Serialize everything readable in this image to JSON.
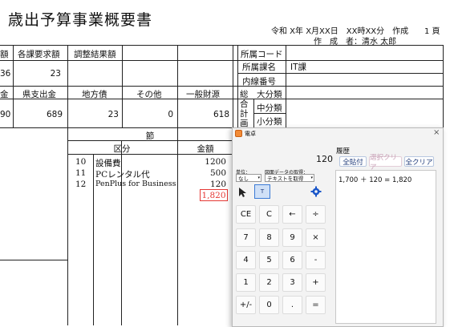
{
  "document": {
    "title": "歳出予算事業概要書",
    "header_date": "令和 X年 X月XX日　XX時XX分　作成",
    "page_number": "1 頁",
    "author": "作　成　者：清水 太郎",
    "row1": {
      "col_a": "額",
      "col_b": "各課要求額",
      "col_c": "調整結果額"
    },
    "row1_values": {
      "a": "36",
      "b": "23"
    },
    "row2": {
      "col_a": "金",
      "col_b": "県支出金",
      "col_c": "地方債",
      "col_d": "その他",
      "col_e": "一般財源"
    },
    "row2_values": {
      "a": "90",
      "b": "689",
      "c": "23",
      "d": "0",
      "e": "618"
    },
    "dept": {
      "code_label": "所属コード",
      "name_label": "所属課名",
      "name_value": "IT課",
      "ext_label": "内線番号"
    },
    "plan": {
      "label1": "総",
      "label2": "合",
      "label3": "計",
      "label4": "画",
      "large": "大分類",
      "mid": "中分類",
      "small": "小分類"
    },
    "section": {
      "header": "節",
      "col_category": "区分",
      "col_amount": "金額"
    },
    "items": [
      {
        "code": "10",
        "name": "設備費",
        "amount": "1200"
      },
      {
        "code": "11",
        "name": "PCレンタル代",
        "amount": "500"
      },
      {
        "code": "12",
        "name": "PenPlus for Business",
        "amount": "120"
      }
    ],
    "total": "1,820"
  },
  "calculator": {
    "window_title": "電卓",
    "close_glyph": "×",
    "display_value": "120",
    "unit_label": "単位：",
    "unit_value": "なし",
    "figure_label": "図面データの取得：",
    "figure_value": "テキストを取得",
    "history_label": "履歴",
    "btn_paste_all": "全貼付",
    "btn_sel_clear": "選択クリア",
    "btn_all_clear": "全クリア",
    "history_entries": [
      "1,700 ＋ 120 = 1,820"
    ],
    "keys": [
      [
        "CE",
        "C",
        "←",
        "÷"
      ],
      [
        "7",
        "8",
        "9",
        "×"
      ],
      [
        "4",
        "5",
        "6",
        "-"
      ],
      [
        "1",
        "2",
        "3",
        "+"
      ],
      [
        "+/-",
        "0",
        ".",
        "="
      ]
    ],
    "colors": {
      "accent": "#1f5fbf",
      "highlight_box": "#e53935",
      "gear": "#1a56c9"
    }
  }
}
